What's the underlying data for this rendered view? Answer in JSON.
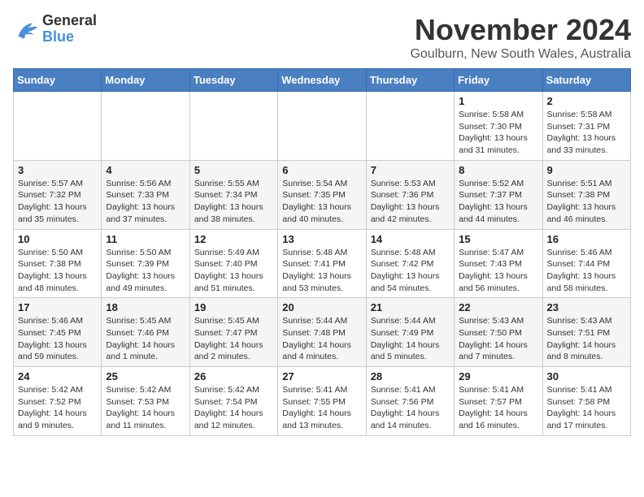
{
  "logo": {
    "general": "General",
    "blue": "Blue"
  },
  "title": "November 2024",
  "subtitle": "Goulburn, New South Wales, Australia",
  "days_of_week": [
    "Sunday",
    "Monday",
    "Tuesday",
    "Wednesday",
    "Thursday",
    "Friday",
    "Saturday"
  ],
  "weeks": [
    [
      {
        "day": "",
        "info": ""
      },
      {
        "day": "",
        "info": ""
      },
      {
        "day": "",
        "info": ""
      },
      {
        "day": "",
        "info": ""
      },
      {
        "day": "",
        "info": ""
      },
      {
        "day": "1",
        "info": "Sunrise: 5:58 AM\nSunset: 7:30 PM\nDaylight: 13 hours and 31 minutes."
      },
      {
        "day": "2",
        "info": "Sunrise: 5:58 AM\nSunset: 7:31 PM\nDaylight: 13 hours and 33 minutes."
      }
    ],
    [
      {
        "day": "3",
        "info": "Sunrise: 5:57 AM\nSunset: 7:32 PM\nDaylight: 13 hours and 35 minutes."
      },
      {
        "day": "4",
        "info": "Sunrise: 5:56 AM\nSunset: 7:33 PM\nDaylight: 13 hours and 37 minutes."
      },
      {
        "day": "5",
        "info": "Sunrise: 5:55 AM\nSunset: 7:34 PM\nDaylight: 13 hours and 38 minutes."
      },
      {
        "day": "6",
        "info": "Sunrise: 5:54 AM\nSunset: 7:35 PM\nDaylight: 13 hours and 40 minutes."
      },
      {
        "day": "7",
        "info": "Sunrise: 5:53 AM\nSunset: 7:36 PM\nDaylight: 13 hours and 42 minutes."
      },
      {
        "day": "8",
        "info": "Sunrise: 5:52 AM\nSunset: 7:37 PM\nDaylight: 13 hours and 44 minutes."
      },
      {
        "day": "9",
        "info": "Sunrise: 5:51 AM\nSunset: 7:38 PM\nDaylight: 13 hours and 46 minutes."
      }
    ],
    [
      {
        "day": "10",
        "info": "Sunrise: 5:50 AM\nSunset: 7:38 PM\nDaylight: 13 hours and 48 minutes."
      },
      {
        "day": "11",
        "info": "Sunrise: 5:50 AM\nSunset: 7:39 PM\nDaylight: 13 hours and 49 minutes."
      },
      {
        "day": "12",
        "info": "Sunrise: 5:49 AM\nSunset: 7:40 PM\nDaylight: 13 hours and 51 minutes."
      },
      {
        "day": "13",
        "info": "Sunrise: 5:48 AM\nSunset: 7:41 PM\nDaylight: 13 hours and 53 minutes."
      },
      {
        "day": "14",
        "info": "Sunrise: 5:48 AM\nSunset: 7:42 PM\nDaylight: 13 hours and 54 minutes."
      },
      {
        "day": "15",
        "info": "Sunrise: 5:47 AM\nSunset: 7:43 PM\nDaylight: 13 hours and 56 minutes."
      },
      {
        "day": "16",
        "info": "Sunrise: 5:46 AM\nSunset: 7:44 PM\nDaylight: 13 hours and 58 minutes."
      }
    ],
    [
      {
        "day": "17",
        "info": "Sunrise: 5:46 AM\nSunset: 7:45 PM\nDaylight: 13 hours and 59 minutes."
      },
      {
        "day": "18",
        "info": "Sunrise: 5:45 AM\nSunset: 7:46 PM\nDaylight: 14 hours and 1 minute."
      },
      {
        "day": "19",
        "info": "Sunrise: 5:45 AM\nSunset: 7:47 PM\nDaylight: 14 hours and 2 minutes."
      },
      {
        "day": "20",
        "info": "Sunrise: 5:44 AM\nSunset: 7:48 PM\nDaylight: 14 hours and 4 minutes."
      },
      {
        "day": "21",
        "info": "Sunrise: 5:44 AM\nSunset: 7:49 PM\nDaylight: 14 hours and 5 minutes."
      },
      {
        "day": "22",
        "info": "Sunrise: 5:43 AM\nSunset: 7:50 PM\nDaylight: 14 hours and 7 minutes."
      },
      {
        "day": "23",
        "info": "Sunrise: 5:43 AM\nSunset: 7:51 PM\nDaylight: 14 hours and 8 minutes."
      }
    ],
    [
      {
        "day": "24",
        "info": "Sunrise: 5:42 AM\nSunset: 7:52 PM\nDaylight: 14 hours and 9 minutes."
      },
      {
        "day": "25",
        "info": "Sunrise: 5:42 AM\nSunset: 7:53 PM\nDaylight: 14 hours and 11 minutes."
      },
      {
        "day": "26",
        "info": "Sunrise: 5:42 AM\nSunset: 7:54 PM\nDaylight: 14 hours and 12 minutes."
      },
      {
        "day": "27",
        "info": "Sunrise: 5:41 AM\nSunset: 7:55 PM\nDaylight: 14 hours and 13 minutes."
      },
      {
        "day": "28",
        "info": "Sunrise: 5:41 AM\nSunset: 7:56 PM\nDaylight: 14 hours and 14 minutes."
      },
      {
        "day": "29",
        "info": "Sunrise: 5:41 AM\nSunset: 7:57 PM\nDaylight: 14 hours and 16 minutes."
      },
      {
        "day": "30",
        "info": "Sunrise: 5:41 AM\nSunset: 7:58 PM\nDaylight: 14 hours and 17 minutes."
      }
    ]
  ]
}
